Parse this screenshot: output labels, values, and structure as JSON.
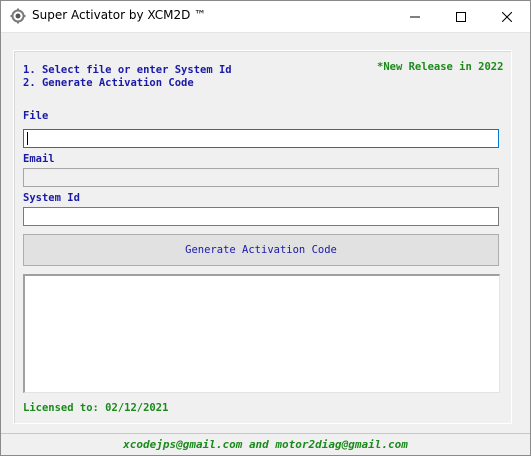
{
  "window": {
    "title": "Super Activator by XCM2D ™",
    "icon": "gear-app-icon",
    "controls": [
      "minimize",
      "maximize",
      "close"
    ]
  },
  "instructions": {
    "step1": "1. Select file or enter System Id",
    "step2": "2. Generate Activation Code",
    "release_note": "*New Release in 2022"
  },
  "form": {
    "file_label": "File",
    "file_value": "",
    "email_label": "Email",
    "email_value": "",
    "system_id_label": "System Id",
    "system_id_value": "",
    "generate_button_label": "Generate Activation Code",
    "output_value": ""
  },
  "license": {
    "text": "Licensed to: 02/12/2021"
  },
  "footer": {
    "contact": "xcodejps@gmail.com and motor2diag@gmail.com"
  },
  "colors": {
    "label_blue": "#1a1aa8",
    "accent_green": "#1b8a1b",
    "focus_border": "#0078d7"
  }
}
